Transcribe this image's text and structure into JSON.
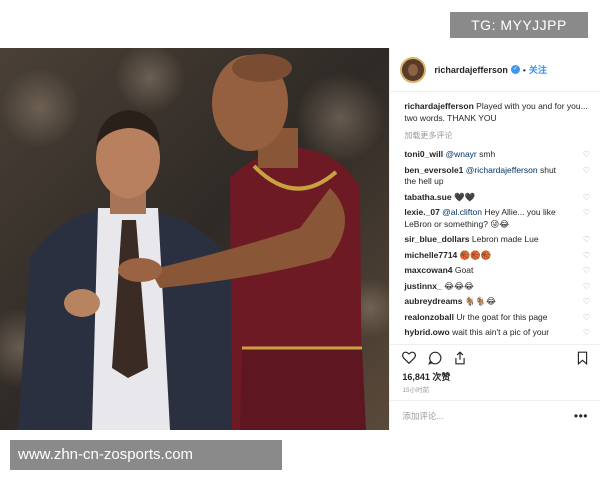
{
  "top_badge": "TG: MYYJJPP",
  "bottom_watermark": "www.zhn-cn-zosports.com",
  "post": {
    "username": "richardajefferson",
    "follow_label": "关注",
    "caption_user": "richardajefferson",
    "caption_text": "Played with you and for you... two words. THANK YOU",
    "load_more": "加载更多评论",
    "comments": [
      {
        "user": "toni0_will",
        "mention": "@wnayr",
        "text": "smh"
      },
      {
        "user": "ben_eversole1",
        "mention": "@richardajefferson",
        "text": "shut the hell up"
      },
      {
        "user": "tabatha.sue",
        "mention": "",
        "text": "🖤🖤"
      },
      {
        "user": "lexie._07",
        "mention": "@al.clifton",
        "text": "Hey Allie... you like LeBron or something? 😜😂"
      },
      {
        "user": "sir_blue_dollars",
        "mention": "",
        "text": "Lebron made Lue"
      },
      {
        "user": "michelle7714",
        "mention": "",
        "text": "🏀🏀🏀"
      },
      {
        "user": "maxcowan4",
        "mention": "",
        "text": "Goat"
      },
      {
        "user": "justinnx_",
        "mention": "",
        "text": "😂😂😂"
      },
      {
        "user": "aubreydreams",
        "mention": "",
        "text": "🐐🐐😂"
      },
      {
        "user": "realonzoball",
        "mention": "",
        "text": "Ur the goat for this page"
      },
      {
        "user": "hybrid.owo",
        "mention": "",
        "text": "wait this ain't a pic of your"
      }
    ],
    "likes": "16,841 次赞",
    "time_ago": "15小时前",
    "add_comment_placeholder": "添加评论...",
    "more_dots": "•••"
  }
}
